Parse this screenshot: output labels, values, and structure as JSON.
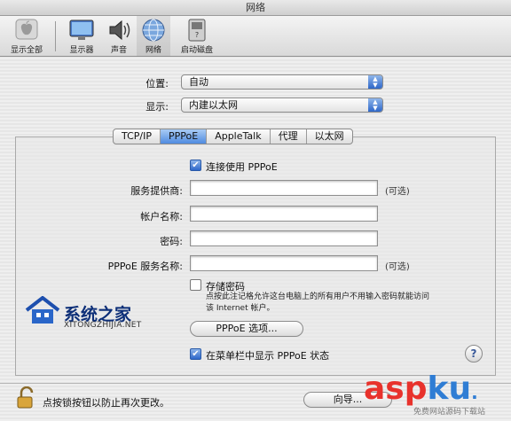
{
  "window": {
    "title": "网络"
  },
  "toolbar": {
    "items": [
      {
        "label": "显示全部",
        "icon": "apple-icon"
      },
      {
        "label": "显示器",
        "icon": "display-icon"
      },
      {
        "label": "声音",
        "icon": "speaker-icon"
      },
      {
        "label": "网络",
        "icon": "network-globe-icon",
        "active": true
      },
      {
        "label": "启动磁盘",
        "icon": "disk-icon"
      }
    ]
  },
  "location": {
    "label": "位置:",
    "value": "自动"
  },
  "show": {
    "label": "显示:",
    "value": "内建以太网"
  },
  "tabs": [
    {
      "label": "TCP/IP"
    },
    {
      "label": "PPPoE",
      "active": true
    },
    {
      "label": "AppleTalk"
    },
    {
      "label": "代理"
    },
    {
      "label": "以太网"
    }
  ],
  "pppoe": {
    "connect_label": "连接使用 PPPoE",
    "connect_checked": true,
    "provider_label": "服务提供商:",
    "provider_value": "",
    "account_label": "帐户名称:",
    "account_value": "",
    "password_label": "密码:",
    "password_value": "",
    "service_label": "PPPoE 服务名称:",
    "service_value": "",
    "optional": "(可选)",
    "save_password_label": "存储密码",
    "save_password_checked": false,
    "save_password_note_1": "点按此注记格允许这台电脑上的所有用户不用输入密码就能访问",
    "save_password_note_2": "该 Internet 帐户。",
    "options_button": "PPPoE 选项...",
    "show_status_label": "在菜单栏中显示 PPPoE 状态",
    "show_status_checked": true,
    "help": "?"
  },
  "bottom": {
    "lock_text": "点按锁按钮以防止再次更改。",
    "assist_button": "向导..."
  },
  "watermark": {
    "left_cn": "系统之家",
    "left_en": "XITONGZHIJIA.NET",
    "right_asp": "asp",
    "right_ku": "ku",
    "right_sub": "免费网站源码下载站"
  },
  "colors": {
    "accent": "#2e67c9",
    "tab_active": "#4f8be0"
  }
}
